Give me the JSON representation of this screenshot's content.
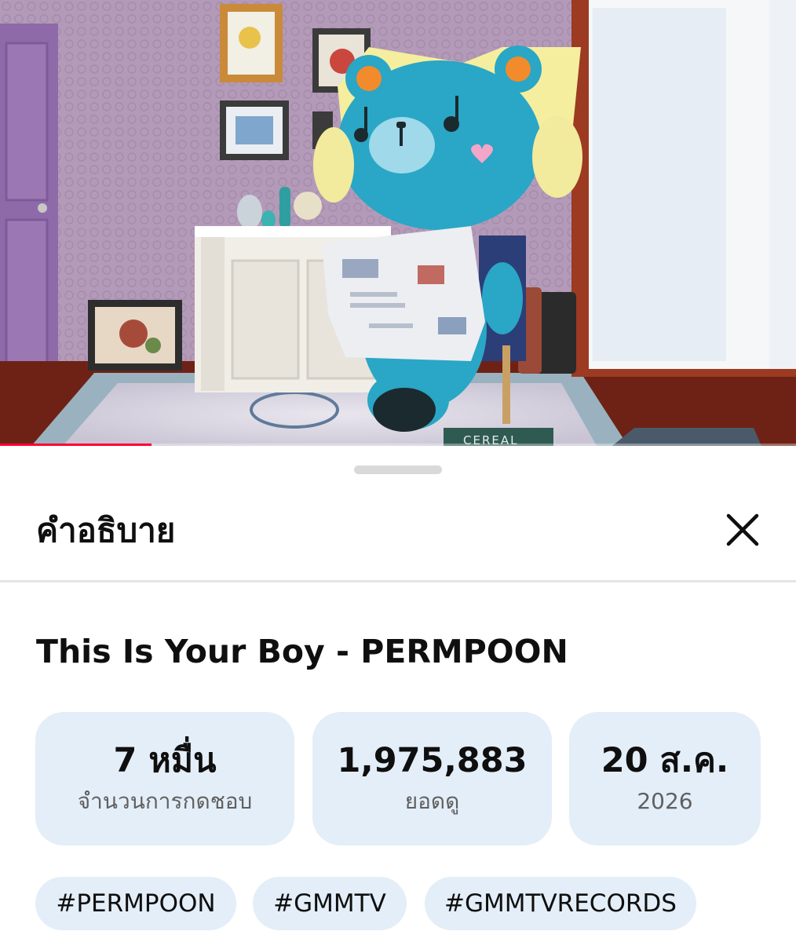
{
  "video": {
    "scene": "blue bear mascot with yellow headphones reading a newspaper in a lilac room",
    "progress_fraction": 0.19,
    "box_text": "CEREAL",
    "colors": {
      "progress": "#ff0033",
      "mascot": "#2aa6c6",
      "headphones": "#f2ea9c"
    }
  },
  "sheet": {
    "title": "คำอธิบาย",
    "close_icon": "close-icon"
  },
  "video_title": "This Is Your Boy - PERMPOON",
  "stats": {
    "likes": {
      "value": "7 หมื่น",
      "label": "จำนวนการกดชอบ"
    },
    "views": {
      "value": "1,975,883",
      "label": "ยอดดู"
    },
    "date": {
      "value": "20 ส.ค.",
      "label": "2026"
    }
  },
  "tags": [
    "#PERMPOON",
    "#GMMTV",
    "#GMMTVRECORDS"
  ],
  "colors": {
    "chip_bg": "#e3eef8",
    "secondary_text": "#606060"
  }
}
